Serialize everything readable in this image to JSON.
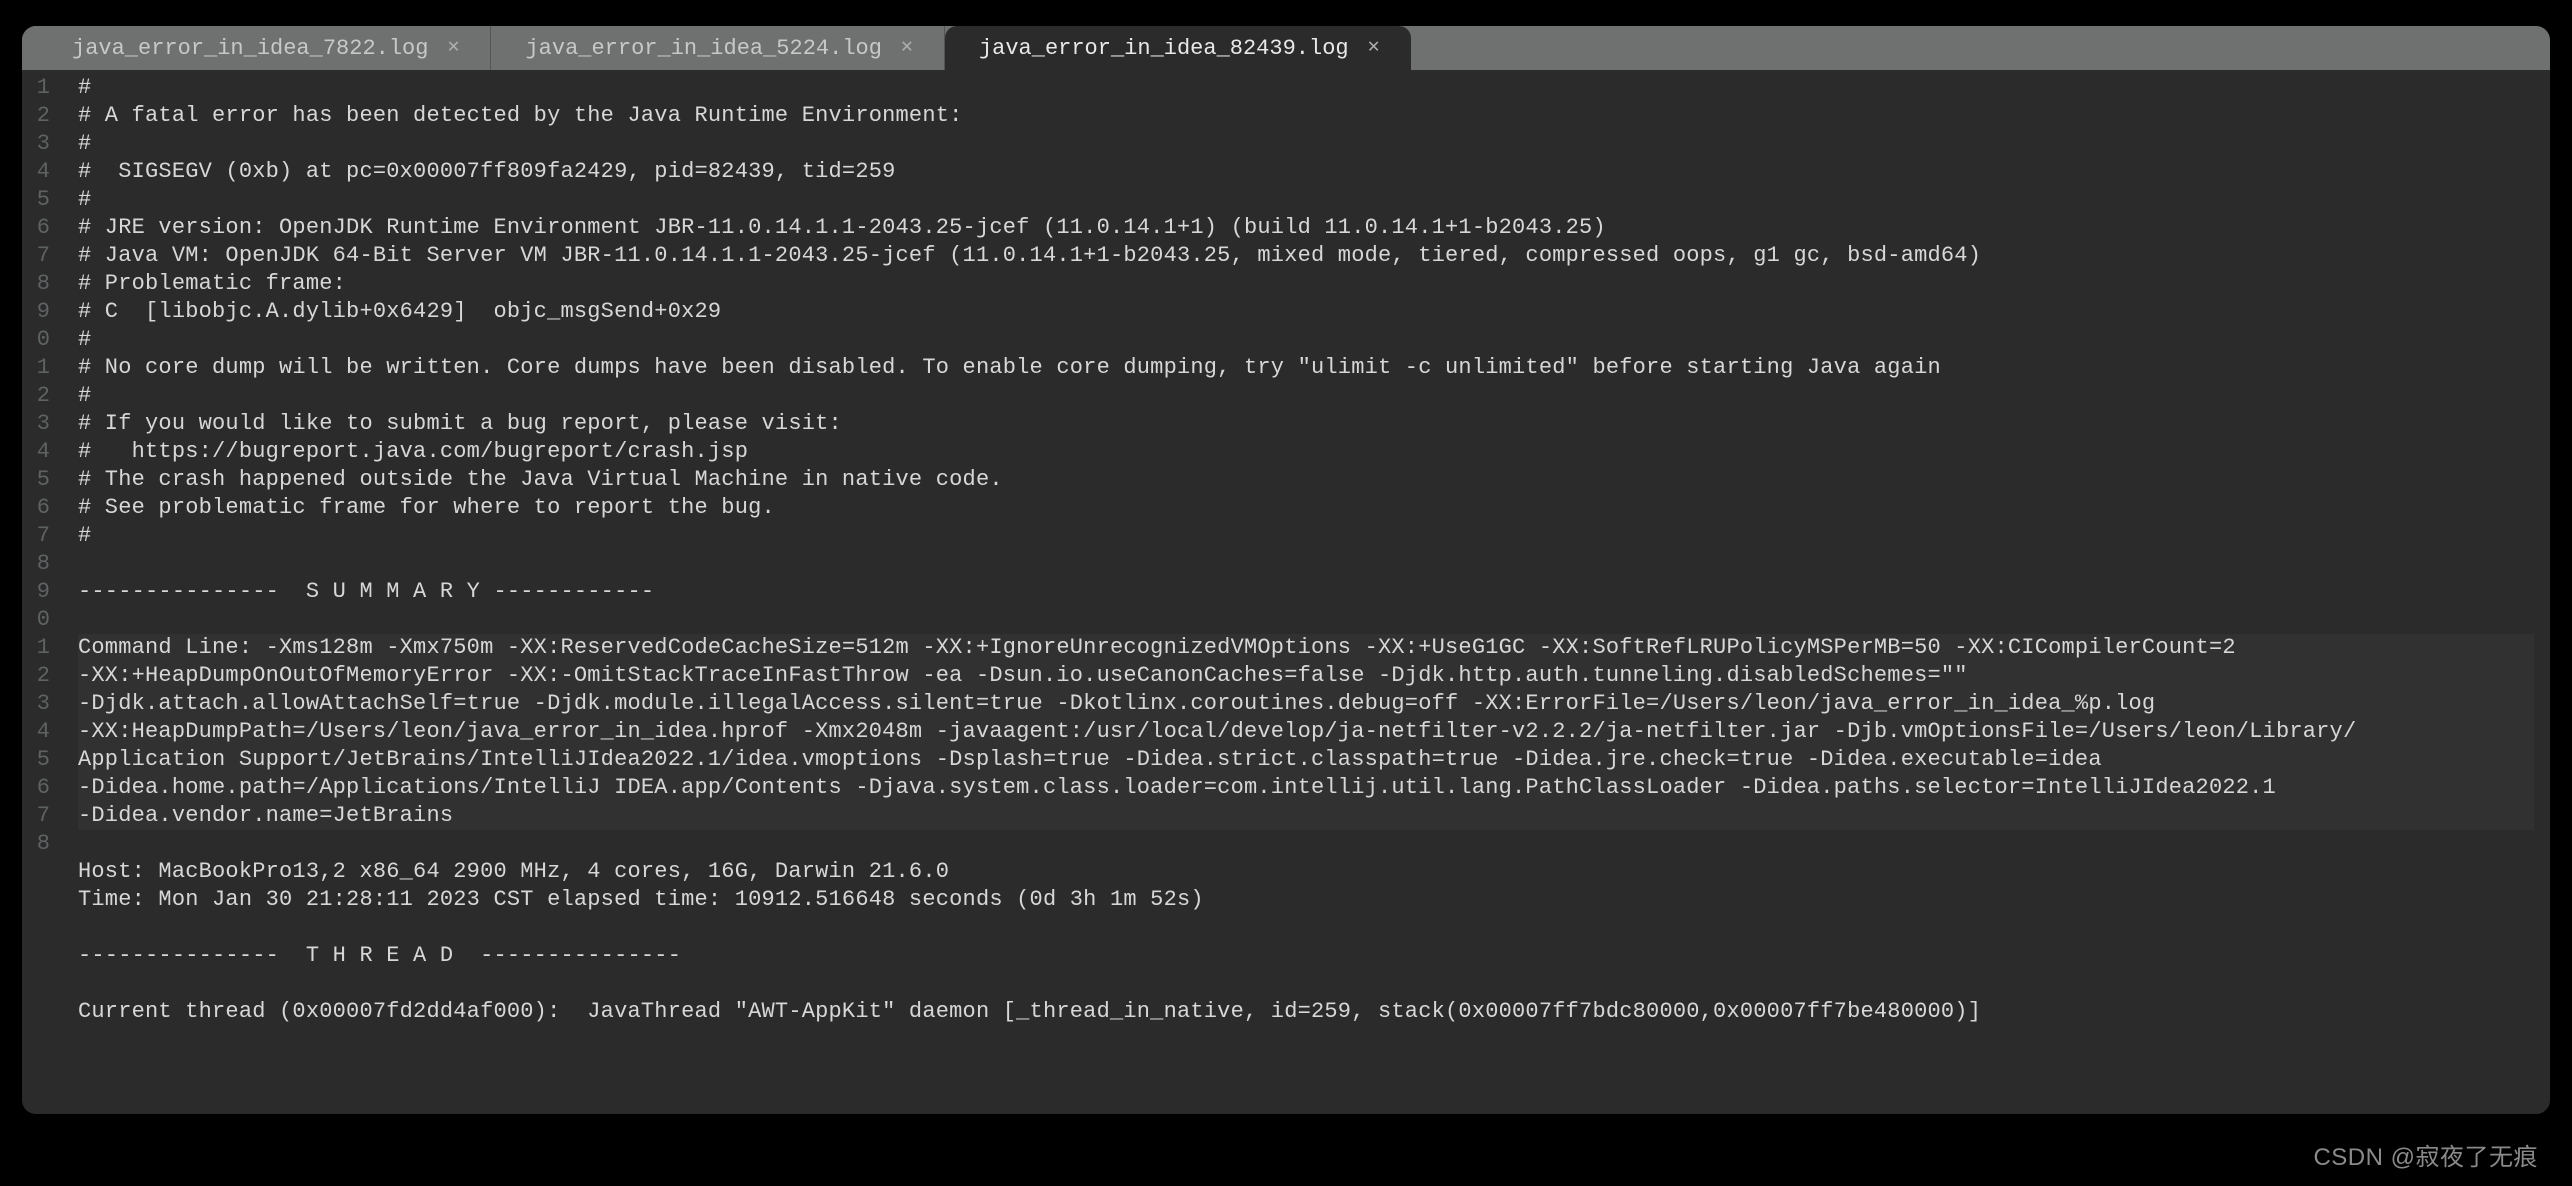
{
  "tabs": [
    {
      "label": "java_error_in_idea_7822.log",
      "active": false
    },
    {
      "label": "java_error_in_idea_5224.log",
      "active": false
    },
    {
      "label": "java_error_in_idea_82439.log",
      "active": true
    }
  ],
  "gutter_digits": [
    "1",
    "2",
    "3",
    "4",
    "5",
    "6",
    "7",
    "8",
    "9",
    "0",
    "1",
    "2",
    "3",
    "4",
    "5",
    "6",
    "7",
    "8",
    "9",
    "0",
    "1",
    "",
    "",
    "",
    "",
    "",
    "",
    "2",
    "3",
    "4",
    "5",
    "6",
    "7",
    "8"
  ],
  "lines": [
    "#",
    "# A fatal error has been detected by the Java Runtime Environment:",
    "#",
    "#  SIGSEGV (0xb) at pc=0x00007ff809fa2429, pid=82439, tid=259",
    "#",
    "# JRE version: OpenJDK Runtime Environment JBR-11.0.14.1.1-2043.25-jcef (11.0.14.1+1) (build 11.0.14.1+1-b2043.25)",
    "# Java VM: OpenJDK 64-Bit Server VM JBR-11.0.14.1.1-2043.25-jcef (11.0.14.1+1-b2043.25, mixed mode, tiered, compressed oops, g1 gc, bsd-amd64)",
    "# Problematic frame:",
    "# C  [libobjc.A.dylib+0x6429]  objc_msgSend+0x29",
    "#",
    "# No core dump will be written. Core dumps have been disabled. To enable core dumping, try \"ulimit -c unlimited\" before starting Java again",
    "#",
    "# If you would like to submit a bug report, please visit:",
    "#   https://bugreport.java.com/bugreport/crash.jsp",
    "# The crash happened outside the Java Virtual Machine in native code.",
    "# See problematic frame for where to report the bug.",
    "#",
    "",
    "---------------  S U M M A R Y ------------",
    "",
    "Command Line: -Xms128m -Xmx750m -XX:ReservedCodeCacheSize=512m -XX:+IgnoreUnrecognizedVMOptions -XX:+UseG1GC -XX:SoftRefLRUPolicyMSPerMB=50 -XX:CICompilerCount=2 ",
    "-XX:+HeapDumpOnOutOfMemoryError -XX:-OmitStackTraceInFastThrow -ea -Dsun.io.useCanonCaches=false -Djdk.http.auth.tunneling.disabledSchemes=\"\" ",
    "-Djdk.attach.allowAttachSelf=true -Djdk.module.illegalAccess.silent=true -Dkotlinx.coroutines.debug=off -XX:ErrorFile=/Users/leon/java_error_in_idea_%p.log ",
    "-XX:HeapDumpPath=/Users/leon/java_error_in_idea.hprof -Xmx2048m -javaagent:/usr/local/develop/ja-netfilter-v2.2.2/ja-netfilter.jar -Djb.vmOptionsFile=/Users/leon/Library/",
    "Application Support/JetBrains/IntelliJIdea2022.1/idea.vmoptions -Dsplash=true -Didea.strict.classpath=true -Didea.jre.check=true -Didea.executable=idea ",
    "-Didea.home.path=/Applications/IntelliJ IDEA.app/Contents -Djava.system.class.loader=com.intellij.util.lang.PathClassLoader -Didea.paths.selector=IntelliJIdea2022.1 ",
    "-Didea.vendor.name=JetBrains",
    "",
    "Host: MacBookPro13,2 x86_64 2900 MHz, 4 cores, 16G, Darwin 21.6.0",
    "Time: Mon Jan 30 21:28:11 2023 CST elapsed time: 10912.516648 seconds (0d 3h 1m 52s)",
    "",
    "---------------  T H R E A D  ---------------",
    "",
    "Current thread (0x00007fd2dd4af000):  JavaThread \"AWT-AppKit\" daemon [_thread_in_native, id=259, stack(0x00007ff7bdc80000,0x00007ff7be480000)]"
  ],
  "footer": "CSDN @寂夜了无痕"
}
